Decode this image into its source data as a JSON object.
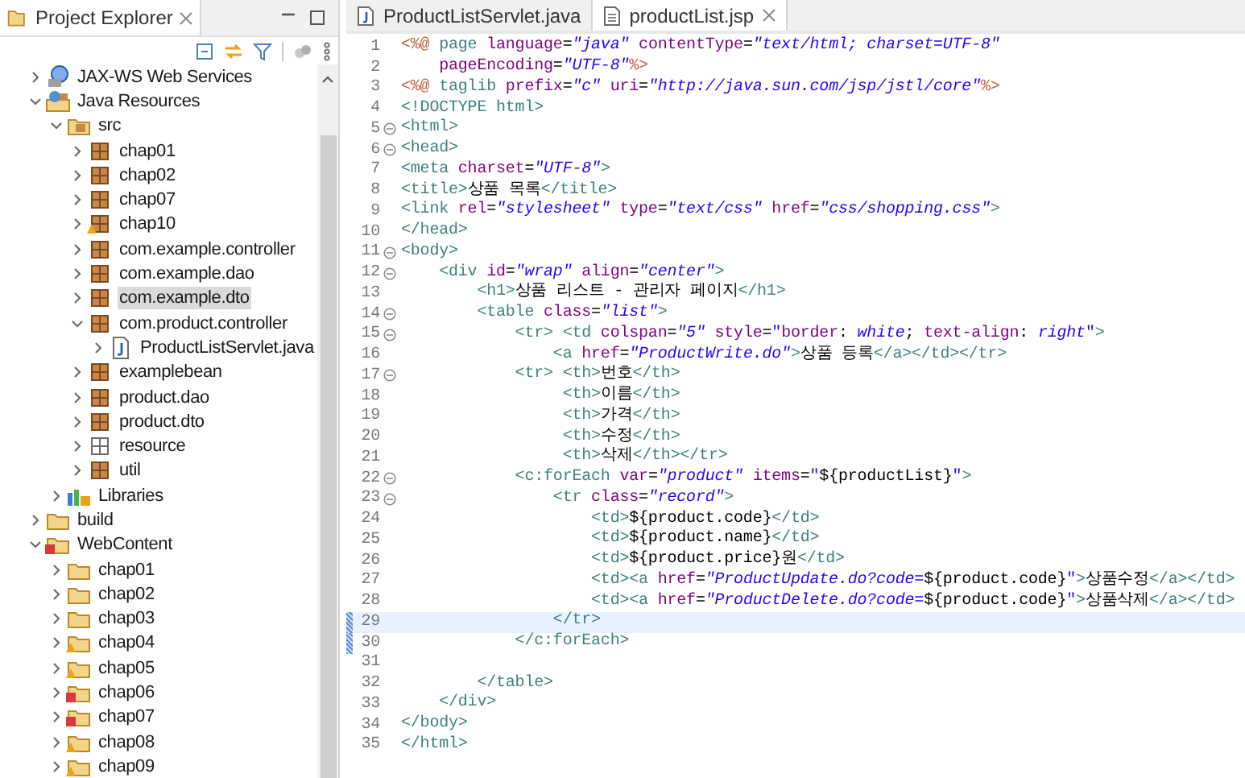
{
  "explorer": {
    "title": "Project Explorer",
    "tree": [
      {
        "label": "JAX-WS Web Services",
        "kind": "services",
        "warning": false,
        "error": false,
        "expanded": false,
        "selected": false
      },
      {
        "label": "Java Resources",
        "kind": "resources",
        "warning": false,
        "error": false,
        "expanded": true,
        "selected": false,
        "children": [
          {
            "label": "src",
            "kind": "source",
            "warning": false,
            "error": false,
            "expanded": true,
            "selected": false,
            "children": [
              {
                "label": "chap01",
                "kind": "package",
                "warning": false,
                "error": false,
                "expanded": false,
                "selected": false
              },
              {
                "label": "chap02",
                "kind": "package",
                "warning": false,
                "error": false,
                "expanded": false,
                "selected": false
              },
              {
                "label": "chap07",
                "kind": "package",
                "warning": false,
                "error": false,
                "expanded": false,
                "selected": false
              },
              {
                "label": "chap10",
                "kind": "package",
                "warning": true,
                "error": false,
                "expanded": false,
                "selected": false
              },
              {
                "label": "com.example.controller",
                "kind": "package",
                "warning": false,
                "error": false,
                "expanded": false,
                "selected": false
              },
              {
                "label": "com.example.dao",
                "kind": "package",
                "warning": false,
                "error": false,
                "expanded": false,
                "selected": false
              },
              {
                "label": "com.example.dto",
                "kind": "package",
                "warning": false,
                "error": false,
                "expanded": false,
                "selected": true
              },
              {
                "label": "com.product.controller",
                "kind": "package",
                "warning": false,
                "error": false,
                "expanded": true,
                "selected": false,
                "children": [
                  {
                    "label": "ProductListServlet.java",
                    "kind": "file",
                    "warning": false,
                    "error": false,
                    "expanded": false,
                    "selected": false
                  }
                ]
              },
              {
                "label": "examplebean",
                "kind": "package",
                "warning": false,
                "error": false,
                "expanded": false,
                "selected": false
              },
              {
                "label": "product.dao",
                "kind": "package",
                "warning": false,
                "error": false,
                "expanded": false,
                "selected": false
              },
              {
                "label": "product.dto",
                "kind": "package",
                "warning": false,
                "error": false,
                "expanded": false,
                "selected": false
              },
              {
                "label": "resource",
                "kind": "empty-package",
                "warning": false,
                "error": false,
                "expanded": false,
                "selected": false
              },
              {
                "label": "util",
                "kind": "package",
                "warning": false,
                "error": false,
                "expanded": false,
                "selected": false
              }
            ]
          },
          {
            "label": "Libraries",
            "kind": "libraries",
            "warning": false,
            "error": false,
            "expanded": false,
            "selected": false
          }
        ]
      },
      {
        "label": "build",
        "kind": "folder",
        "warning": false,
        "error": false,
        "expanded": false,
        "selected": false
      },
      {
        "label": "WebContent",
        "kind": "folder",
        "warning": false,
        "error": true,
        "expanded": true,
        "selected": false,
        "children": [
          {
            "label": "chap01",
            "kind": "folder",
            "warning": false,
            "error": false,
            "expanded": false,
            "selected": false
          },
          {
            "label": "chap02",
            "kind": "folder",
            "warning": false,
            "error": false,
            "expanded": false,
            "selected": false
          },
          {
            "label": "chap03",
            "kind": "folder",
            "warning": false,
            "error": false,
            "expanded": false,
            "selected": false
          },
          {
            "label": "chap04",
            "kind": "folder",
            "warning": true,
            "error": false,
            "expanded": false,
            "selected": false
          },
          {
            "label": "chap05",
            "kind": "folder",
            "warning": true,
            "error": false,
            "expanded": false,
            "selected": false
          },
          {
            "label": "chap06",
            "kind": "folder",
            "warning": false,
            "error": true,
            "expanded": false,
            "selected": false
          },
          {
            "label": "chap07",
            "kind": "folder",
            "warning": false,
            "error": true,
            "expanded": false,
            "selected": false
          },
          {
            "label": "chap08",
            "kind": "folder",
            "warning": true,
            "error": false,
            "expanded": false,
            "selected": false
          },
          {
            "label": "chap09",
            "kind": "folder",
            "warning": true,
            "error": false,
            "expanded": false,
            "selected": false
          }
        ]
      }
    ]
  },
  "editor": {
    "tabs": [
      {
        "label": "ProductListServlet.java",
        "kind": "java",
        "selected": false
      },
      {
        "label": "productList.jsp",
        "kind": "jsp",
        "selected": true
      }
    ],
    "lines": [
      {
        "number": "1",
        "foldable": false,
        "current": false,
        "changed": false,
        "tokens": [
          {
            "kind": "directive",
            "text": "<%@"
          },
          {
            "kind": "tag",
            "text": " page "
          },
          {
            "kind": "attr",
            "text": "language"
          },
          {
            "kind": "plain",
            "text": "="
          },
          {
            "kind": "value",
            "text": "\"java\""
          },
          {
            "kind": "attr",
            "text": " contentType"
          },
          {
            "kind": "plain",
            "text": "="
          },
          {
            "kind": "value",
            "text": "\"text/html; charset=UTF-8\""
          }
        ]
      },
      {
        "number": "2",
        "foldable": false,
        "current": false,
        "changed": false,
        "tokens": [
          {
            "kind": "attr",
            "text": "    pageEncoding"
          },
          {
            "kind": "plain",
            "text": "="
          },
          {
            "kind": "value",
            "text": "\"UTF-8\""
          },
          {
            "kind": "directive",
            "text": "%>"
          }
        ]
      },
      {
        "number": "3",
        "foldable": false,
        "current": false,
        "changed": false,
        "tokens": [
          {
            "kind": "directive",
            "text": "<%@"
          },
          {
            "kind": "tag",
            "text": " taglib "
          },
          {
            "kind": "attr",
            "text": "prefix"
          },
          {
            "kind": "plain",
            "text": "="
          },
          {
            "kind": "value",
            "text": "\"c\""
          },
          {
            "kind": "attr",
            "text": " uri"
          },
          {
            "kind": "plain",
            "text": "="
          },
          {
            "kind": "value",
            "text": "\"http://java.sun.com/jsp/jstl/core\""
          },
          {
            "kind": "directive",
            "text": "%>"
          }
        ]
      },
      {
        "number": "4",
        "foldable": false,
        "current": false,
        "changed": false,
        "tokens": [
          {
            "kind": "tag",
            "text": "<!DOCTYPE html>"
          }
        ]
      },
      {
        "number": "5",
        "foldable": true,
        "current": false,
        "changed": false,
        "tokens": [
          {
            "kind": "tag",
            "text": "<html>"
          }
        ]
      },
      {
        "number": "6",
        "foldable": true,
        "current": false,
        "changed": false,
        "tokens": [
          {
            "kind": "tag",
            "text": "<head>"
          }
        ]
      },
      {
        "number": "7",
        "foldable": false,
        "current": false,
        "changed": false,
        "tokens": [
          {
            "kind": "tag",
            "text": "<meta "
          },
          {
            "kind": "attr",
            "text": "charset"
          },
          {
            "kind": "plain",
            "text": "="
          },
          {
            "kind": "value",
            "text": "\"UTF-8\""
          },
          {
            "kind": "tag",
            "text": ">"
          }
        ]
      },
      {
        "number": "8",
        "foldable": false,
        "current": false,
        "changed": false,
        "tokens": [
          {
            "kind": "tag",
            "text": "<title>"
          },
          {
            "kind": "plain",
            "text": "상품 목록"
          },
          {
            "kind": "tag",
            "text": "</title>"
          }
        ]
      },
      {
        "number": "9",
        "foldable": false,
        "current": false,
        "changed": false,
        "tokens": [
          {
            "kind": "tag",
            "text": "<link "
          },
          {
            "kind": "attr",
            "text": "rel"
          },
          {
            "kind": "plain",
            "text": "="
          },
          {
            "kind": "value",
            "text": "\"stylesheet\""
          },
          {
            "kind": "attr",
            "text": " type"
          },
          {
            "kind": "plain",
            "text": "="
          },
          {
            "kind": "value",
            "text": "\"text/css\""
          },
          {
            "kind": "attr",
            "text": " href"
          },
          {
            "kind": "plain",
            "text": "="
          },
          {
            "kind": "value",
            "text": "\"css/shopping.css\""
          },
          {
            "kind": "tag",
            "text": ">"
          }
        ]
      },
      {
        "number": "10",
        "foldable": false,
        "current": false,
        "changed": false,
        "tokens": [
          {
            "kind": "tag",
            "text": "</head>"
          }
        ]
      },
      {
        "number": "11",
        "foldable": true,
        "current": false,
        "changed": false,
        "tokens": [
          {
            "kind": "tag",
            "text": "<body>"
          }
        ]
      },
      {
        "number": "12",
        "foldable": true,
        "current": false,
        "changed": false,
        "tokens": [
          {
            "kind": "tag",
            "text": "    <div "
          },
          {
            "kind": "attr",
            "text": "id"
          },
          {
            "kind": "plain",
            "text": "="
          },
          {
            "kind": "value",
            "text": "\"wrap\""
          },
          {
            "kind": "attr",
            "text": " align"
          },
          {
            "kind": "plain",
            "text": "="
          },
          {
            "kind": "value",
            "text": "\"center\""
          },
          {
            "kind": "tag",
            "text": ">"
          }
        ]
      },
      {
        "number": "13",
        "foldable": false,
        "current": false,
        "changed": false,
        "tokens": [
          {
            "kind": "tag",
            "text": "        <h1>"
          },
          {
            "kind": "plain",
            "text": "상품 리스트 - 관리자 페이지"
          },
          {
            "kind": "tag",
            "text": "</h1>"
          }
        ]
      },
      {
        "number": "14",
        "foldable": true,
        "current": false,
        "changed": false,
        "tokens": [
          {
            "kind": "tag",
            "text": "        <table "
          },
          {
            "kind": "attr",
            "text": "class"
          },
          {
            "kind": "plain",
            "text": "="
          },
          {
            "kind": "value",
            "text": "\"list\""
          },
          {
            "kind": "tag",
            "text": ">"
          }
        ]
      },
      {
        "number": "15",
        "foldable": true,
        "current": false,
        "changed": false,
        "tokens": [
          {
            "kind": "tag",
            "text": "            <tr> <td "
          },
          {
            "kind": "attr",
            "text": "colspan"
          },
          {
            "kind": "plain",
            "text": "="
          },
          {
            "kind": "value",
            "text": "\"5\""
          },
          {
            "kind": "attr",
            "text": " style"
          },
          {
            "kind": "plain",
            "text": "="
          },
          {
            "kind": "quote",
            "text": "\""
          },
          {
            "kind": "attr",
            "text": "border"
          },
          {
            "kind": "plain",
            "text": ": "
          },
          {
            "kind": "value",
            "text": "white"
          },
          {
            "kind": "plain",
            "text": "; "
          },
          {
            "kind": "attr",
            "text": "text-align"
          },
          {
            "kind": "plain",
            "text": ": "
          },
          {
            "kind": "value",
            "text": "right"
          },
          {
            "kind": "quote",
            "text": "\""
          },
          {
            "kind": "tag",
            "text": ">"
          }
        ]
      },
      {
        "number": "16",
        "foldable": false,
        "current": false,
        "changed": false,
        "tokens": [
          {
            "kind": "tag",
            "text": "                <a "
          },
          {
            "kind": "attr",
            "text": "href"
          },
          {
            "kind": "plain",
            "text": "="
          },
          {
            "kind": "value",
            "text": "\"ProductWrite.do\""
          },
          {
            "kind": "tag",
            "text": ">"
          },
          {
            "kind": "plain",
            "text": "상품 등록"
          },
          {
            "kind": "tag",
            "text": "</a></td></tr>"
          }
        ]
      },
      {
        "number": "17",
        "foldable": true,
        "current": false,
        "changed": false,
        "tokens": [
          {
            "kind": "tag",
            "text": "            <tr> <th>"
          },
          {
            "kind": "plain",
            "text": "번호"
          },
          {
            "kind": "tag",
            "text": "</th>"
          }
        ]
      },
      {
        "number": "18",
        "foldable": false,
        "current": false,
        "changed": false,
        "tokens": [
          {
            "kind": "tag",
            "text": "                 <th>"
          },
          {
            "kind": "plain",
            "text": "이름"
          },
          {
            "kind": "tag",
            "text": "</th>"
          }
        ]
      },
      {
        "number": "19",
        "foldable": false,
        "current": false,
        "changed": false,
        "tokens": [
          {
            "kind": "tag",
            "text": "                 <th>"
          },
          {
            "kind": "plain",
            "text": "가격"
          },
          {
            "kind": "tag",
            "text": "</th>"
          }
        ]
      },
      {
        "number": "20",
        "foldable": false,
        "current": false,
        "changed": false,
        "tokens": [
          {
            "kind": "tag",
            "text": "                 <th>"
          },
          {
            "kind": "plain",
            "text": "수정"
          },
          {
            "kind": "tag",
            "text": "</th>"
          }
        ]
      },
      {
        "number": "21",
        "foldable": false,
        "current": false,
        "changed": false,
        "tokens": [
          {
            "kind": "tag",
            "text": "                 <th>"
          },
          {
            "kind": "plain",
            "text": "삭제"
          },
          {
            "kind": "tag",
            "text": "</th></tr>"
          }
        ]
      },
      {
        "number": "22",
        "foldable": true,
        "current": false,
        "changed": false,
        "tokens": [
          {
            "kind": "tag",
            "text": "            <c:forEach "
          },
          {
            "kind": "attr",
            "text": "var"
          },
          {
            "kind": "plain",
            "text": "="
          },
          {
            "kind": "value",
            "text": "\"product\""
          },
          {
            "kind": "attr",
            "text": " items"
          },
          {
            "kind": "plain",
            "text": "="
          },
          {
            "kind": "quote",
            "text": "\""
          },
          {
            "kind": "plain",
            "text": "${productList}"
          },
          {
            "kind": "quote",
            "text": "\""
          },
          {
            "kind": "tag",
            "text": ">"
          }
        ]
      },
      {
        "number": "23",
        "foldable": true,
        "current": false,
        "changed": false,
        "tokens": [
          {
            "kind": "tag",
            "text": "                <tr "
          },
          {
            "kind": "attr",
            "text": "class"
          },
          {
            "kind": "plain",
            "text": "="
          },
          {
            "kind": "value",
            "text": "\"record\""
          },
          {
            "kind": "tag",
            "text": ">"
          }
        ]
      },
      {
        "number": "24",
        "foldable": false,
        "current": false,
        "changed": false,
        "tokens": [
          {
            "kind": "tag",
            "text": "                    <td>"
          },
          {
            "kind": "plain",
            "text": "${product.code}"
          },
          {
            "kind": "tag",
            "text": "</td>"
          }
        ]
      },
      {
        "number": "25",
        "foldable": false,
        "current": false,
        "changed": false,
        "tokens": [
          {
            "kind": "tag",
            "text": "                    <td>"
          },
          {
            "kind": "plain",
            "text": "${product.name}"
          },
          {
            "kind": "tag",
            "text": "</td>"
          }
        ]
      },
      {
        "number": "26",
        "foldable": false,
        "current": false,
        "changed": false,
        "tokens": [
          {
            "kind": "tag",
            "text": "                    <td>"
          },
          {
            "kind": "plain",
            "text": "${product.price}원"
          },
          {
            "kind": "tag",
            "text": "</td>"
          }
        ]
      },
      {
        "number": "27",
        "foldable": false,
        "current": false,
        "changed": false,
        "tokens": [
          {
            "kind": "tag",
            "text": "                    <td><a "
          },
          {
            "kind": "attr",
            "text": "href"
          },
          {
            "kind": "plain",
            "text": "="
          },
          {
            "kind": "value",
            "text": "\"ProductUpdate.do?code="
          },
          {
            "kind": "plain",
            "text": "${product.code}"
          },
          {
            "kind": "quote",
            "text": "\""
          },
          {
            "kind": "tag",
            "text": ">"
          },
          {
            "kind": "plain",
            "text": "상품수정"
          },
          {
            "kind": "tag",
            "text": "</a></td>"
          }
        ]
      },
      {
        "number": "28",
        "foldable": false,
        "current": false,
        "changed": false,
        "tokens": [
          {
            "kind": "tag",
            "text": "                    <td><a "
          },
          {
            "kind": "attr",
            "text": "href"
          },
          {
            "kind": "plain",
            "text": "="
          },
          {
            "kind": "value",
            "text": "\"ProductDelete.do?code="
          },
          {
            "kind": "plain",
            "text": "${product.code}"
          },
          {
            "kind": "quote",
            "text": "\""
          },
          {
            "kind": "tag",
            "text": ">"
          },
          {
            "kind": "plain",
            "text": "상품삭제"
          },
          {
            "kind": "tag",
            "text": "</a></td>"
          }
        ]
      },
      {
        "number": "29",
        "foldable": false,
        "current": true,
        "changed": true,
        "tokens": [
          {
            "kind": "tag",
            "text": "                </tr>"
          }
        ]
      },
      {
        "number": "30",
        "foldable": false,
        "current": false,
        "changed": true,
        "tokens": [
          {
            "kind": "tag",
            "text": "            </c:forEach>"
          }
        ]
      },
      {
        "number": "31",
        "foldable": false,
        "current": false,
        "changed": false
      },
      {
        "number": "32",
        "foldable": false,
        "current": false,
        "changed": false,
        "tokens": [
          {
            "kind": "tag",
            "text": "        </table>"
          }
        ]
      },
      {
        "number": "33",
        "foldable": false,
        "current": false,
        "changed": false,
        "tokens": [
          {
            "kind": "tag",
            "text": "    </div>"
          }
        ]
      },
      {
        "number": "34",
        "foldable": false,
        "current": false,
        "changed": false,
        "tokens": [
          {
            "kind": "tag",
            "text": "</body>"
          }
        ]
      },
      {
        "number": "35",
        "foldable": false,
        "current": false,
        "changed": false,
        "tokens": [
          {
            "kind": "tag",
            "text": "</html>"
          }
        ]
      }
    ]
  }
}
